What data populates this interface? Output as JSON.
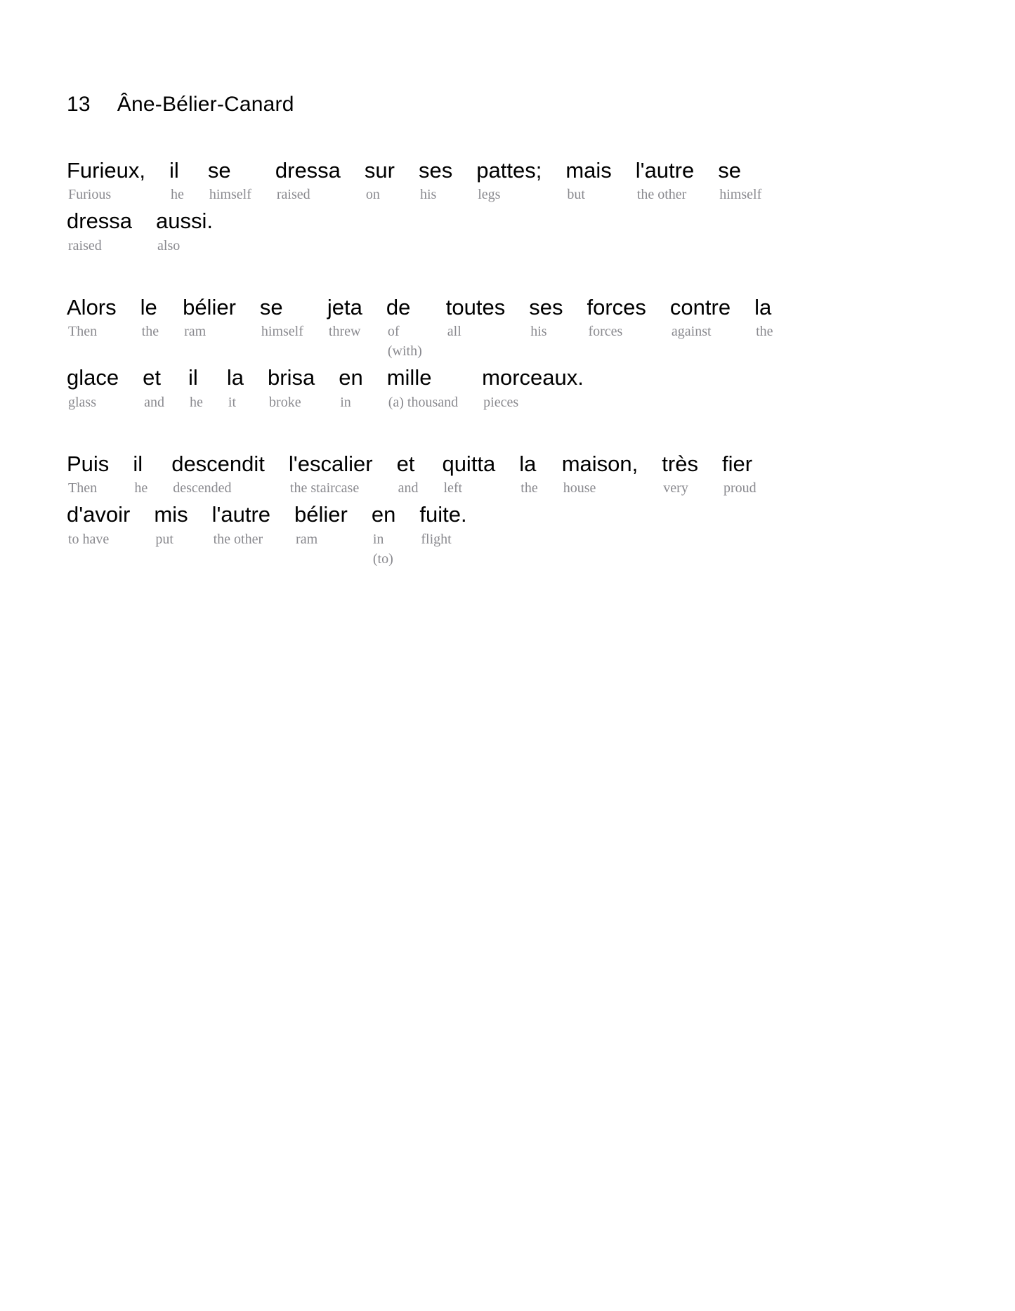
{
  "title": {
    "number": "13",
    "text": "Âne-Bélier-Canard"
  },
  "colors": {
    "text": "#000000",
    "gloss": "#8a8a8f",
    "background": "#ffffff"
  },
  "paragraphs": [
    {
      "id": "paragraph-1",
      "lines": [
        {
          "id": "p1-line-1",
          "words": [
            {
              "fr": "Furieux,",
              "en": "Furious",
              "en2": ""
            },
            {
              "fr": "il",
              "en": "he",
              "en2": ""
            },
            {
              "fr": "se",
              "en": "himself",
              "en2": ""
            },
            {
              "fr": "dressa",
              "en": "raised",
              "en2": ""
            },
            {
              "fr": "sur",
              "en": "on",
              "en2": ""
            },
            {
              "fr": "ses",
              "en": "his",
              "en2": ""
            },
            {
              "fr": "pattes;",
              "en": "legs",
              "en2": ""
            },
            {
              "fr": "mais",
              "en": "but",
              "en2": ""
            },
            {
              "fr": "l'autre",
              "en": "the other",
              "en2": ""
            },
            {
              "fr": "se",
              "en": "himself",
              "en2": ""
            }
          ]
        },
        {
          "id": "p1-line-2",
          "words": [
            {
              "fr": "dressa",
              "en": "raised",
              "en2": ""
            },
            {
              "fr": "aussi.",
              "en": "also",
              "en2": ""
            }
          ]
        }
      ]
    },
    {
      "id": "paragraph-2",
      "lines": [
        {
          "id": "p2-line-1",
          "words": [
            {
              "fr": "Alors",
              "en": "Then",
              "en2": ""
            },
            {
              "fr": "le",
              "en": "the",
              "en2": ""
            },
            {
              "fr": "bélier",
              "en": "ram",
              "en2": ""
            },
            {
              "fr": "se",
              "en": "himself",
              "en2": ""
            },
            {
              "fr": "jeta",
              "en": "threw",
              "en2": ""
            },
            {
              "fr": "de",
              "en": "of",
              "en2": "(with)"
            },
            {
              "fr": "toutes",
              "en": "all",
              "en2": ""
            },
            {
              "fr": "ses",
              "en": "his",
              "en2": ""
            },
            {
              "fr": "forces",
              "en": "forces",
              "en2": ""
            },
            {
              "fr": "contre",
              "en": "against",
              "en2": ""
            },
            {
              "fr": "la",
              "en": "the",
              "en2": ""
            }
          ]
        },
        {
          "id": "p2-line-2",
          "words": [
            {
              "fr": "glace",
              "en": "glass",
              "en2": ""
            },
            {
              "fr": "et",
              "en": "and",
              "en2": ""
            },
            {
              "fr": "il",
              "en": "he",
              "en2": ""
            },
            {
              "fr": "la",
              "en": "it",
              "en2": ""
            },
            {
              "fr": "brisa",
              "en": "broke",
              "en2": ""
            },
            {
              "fr": "en",
              "en": "in",
              "en2": ""
            },
            {
              "fr": "mille",
              "en": "(a) thousand",
              "en2": ""
            },
            {
              "fr": "morceaux.",
              "en": "pieces",
              "en2": ""
            }
          ]
        }
      ]
    },
    {
      "id": "paragraph-3",
      "lines": [
        {
          "id": "p3-line-1",
          "words": [
            {
              "fr": "Puis",
              "en": "Then",
              "en2": ""
            },
            {
              "fr": "il",
              "en": "he",
              "en2": ""
            },
            {
              "fr": "descendit",
              "en": "descended",
              "en2": ""
            },
            {
              "fr": "l'escalier",
              "en": "the staircase",
              "en2": ""
            },
            {
              "fr": "et",
              "en": "and",
              "en2": ""
            },
            {
              "fr": "quitta",
              "en": "left",
              "en2": ""
            },
            {
              "fr": "la",
              "en": "the",
              "en2": ""
            },
            {
              "fr": "maison,",
              "en": "house",
              "en2": ""
            },
            {
              "fr": "très",
              "en": "very",
              "en2": ""
            },
            {
              "fr": "fier",
              "en": "proud",
              "en2": ""
            }
          ]
        },
        {
          "id": "p3-line-2",
          "words": [
            {
              "fr": "d'avoir",
              "en": "to have",
              "en2": ""
            },
            {
              "fr": "mis",
              "en": "put",
              "en2": ""
            },
            {
              "fr": "l'autre",
              "en": "the other",
              "en2": ""
            },
            {
              "fr": "bélier",
              "en": "ram",
              "en2": ""
            },
            {
              "fr": "en",
              "en": "in",
              "en2": "(to)"
            },
            {
              "fr": "fuite.",
              "en": "flight",
              "en2": ""
            }
          ]
        }
      ]
    }
  ]
}
